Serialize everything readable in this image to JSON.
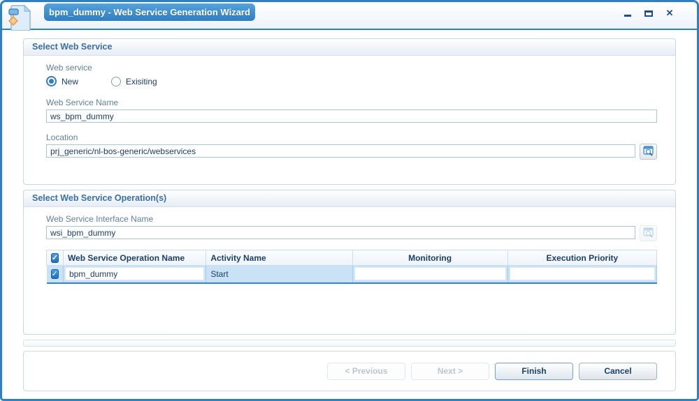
{
  "window": {
    "title": "bpm_dummy - Web Service Generation Wizard",
    "icons": {
      "close": "✕"
    }
  },
  "select_web_service": {
    "header": "Select Web Service",
    "web_service_label": "Web service",
    "options": {
      "new": "New",
      "existing": "Exisiting"
    },
    "selected_option": "New",
    "name_label": "Web Service Name",
    "name_value": "ws_bpm_dummy",
    "location_label": "Location",
    "location_value": "prj_generic/nl-bos-generic/webservices"
  },
  "select_operations": {
    "header": "Select Web Service Operation(s)",
    "interface_label": "Web Service Interface Name",
    "interface_value": "wsi_bpm_dummy",
    "table": {
      "columns": [
        "Web Service Operation Name",
        "Activity Name",
        "Monitoring",
        "Execution Priority"
      ],
      "header_checkbox_checked": true,
      "rows": [
        {
          "checked": true,
          "operation_name": "bpm_dummy",
          "activity_name": "Start",
          "monitoring": "",
          "execution_priority": ""
        }
      ]
    }
  },
  "footer": {
    "previous": "< Previous",
    "next": "Next >",
    "finish": "Finish",
    "cancel": "Cancel"
  },
  "colors": {
    "window_border": "#2e7fc4",
    "title_tab_blue": "#3b8fd4",
    "section_header_text": "#3a6fa8",
    "label_text": "#60809f",
    "value_text": "#1c3e6e",
    "row_highlight": "#c9e2f6",
    "checkbox_blue": "#2b82cc",
    "table_bottom_border": "#3585cd",
    "disabled_text": "#b9c6d4"
  }
}
